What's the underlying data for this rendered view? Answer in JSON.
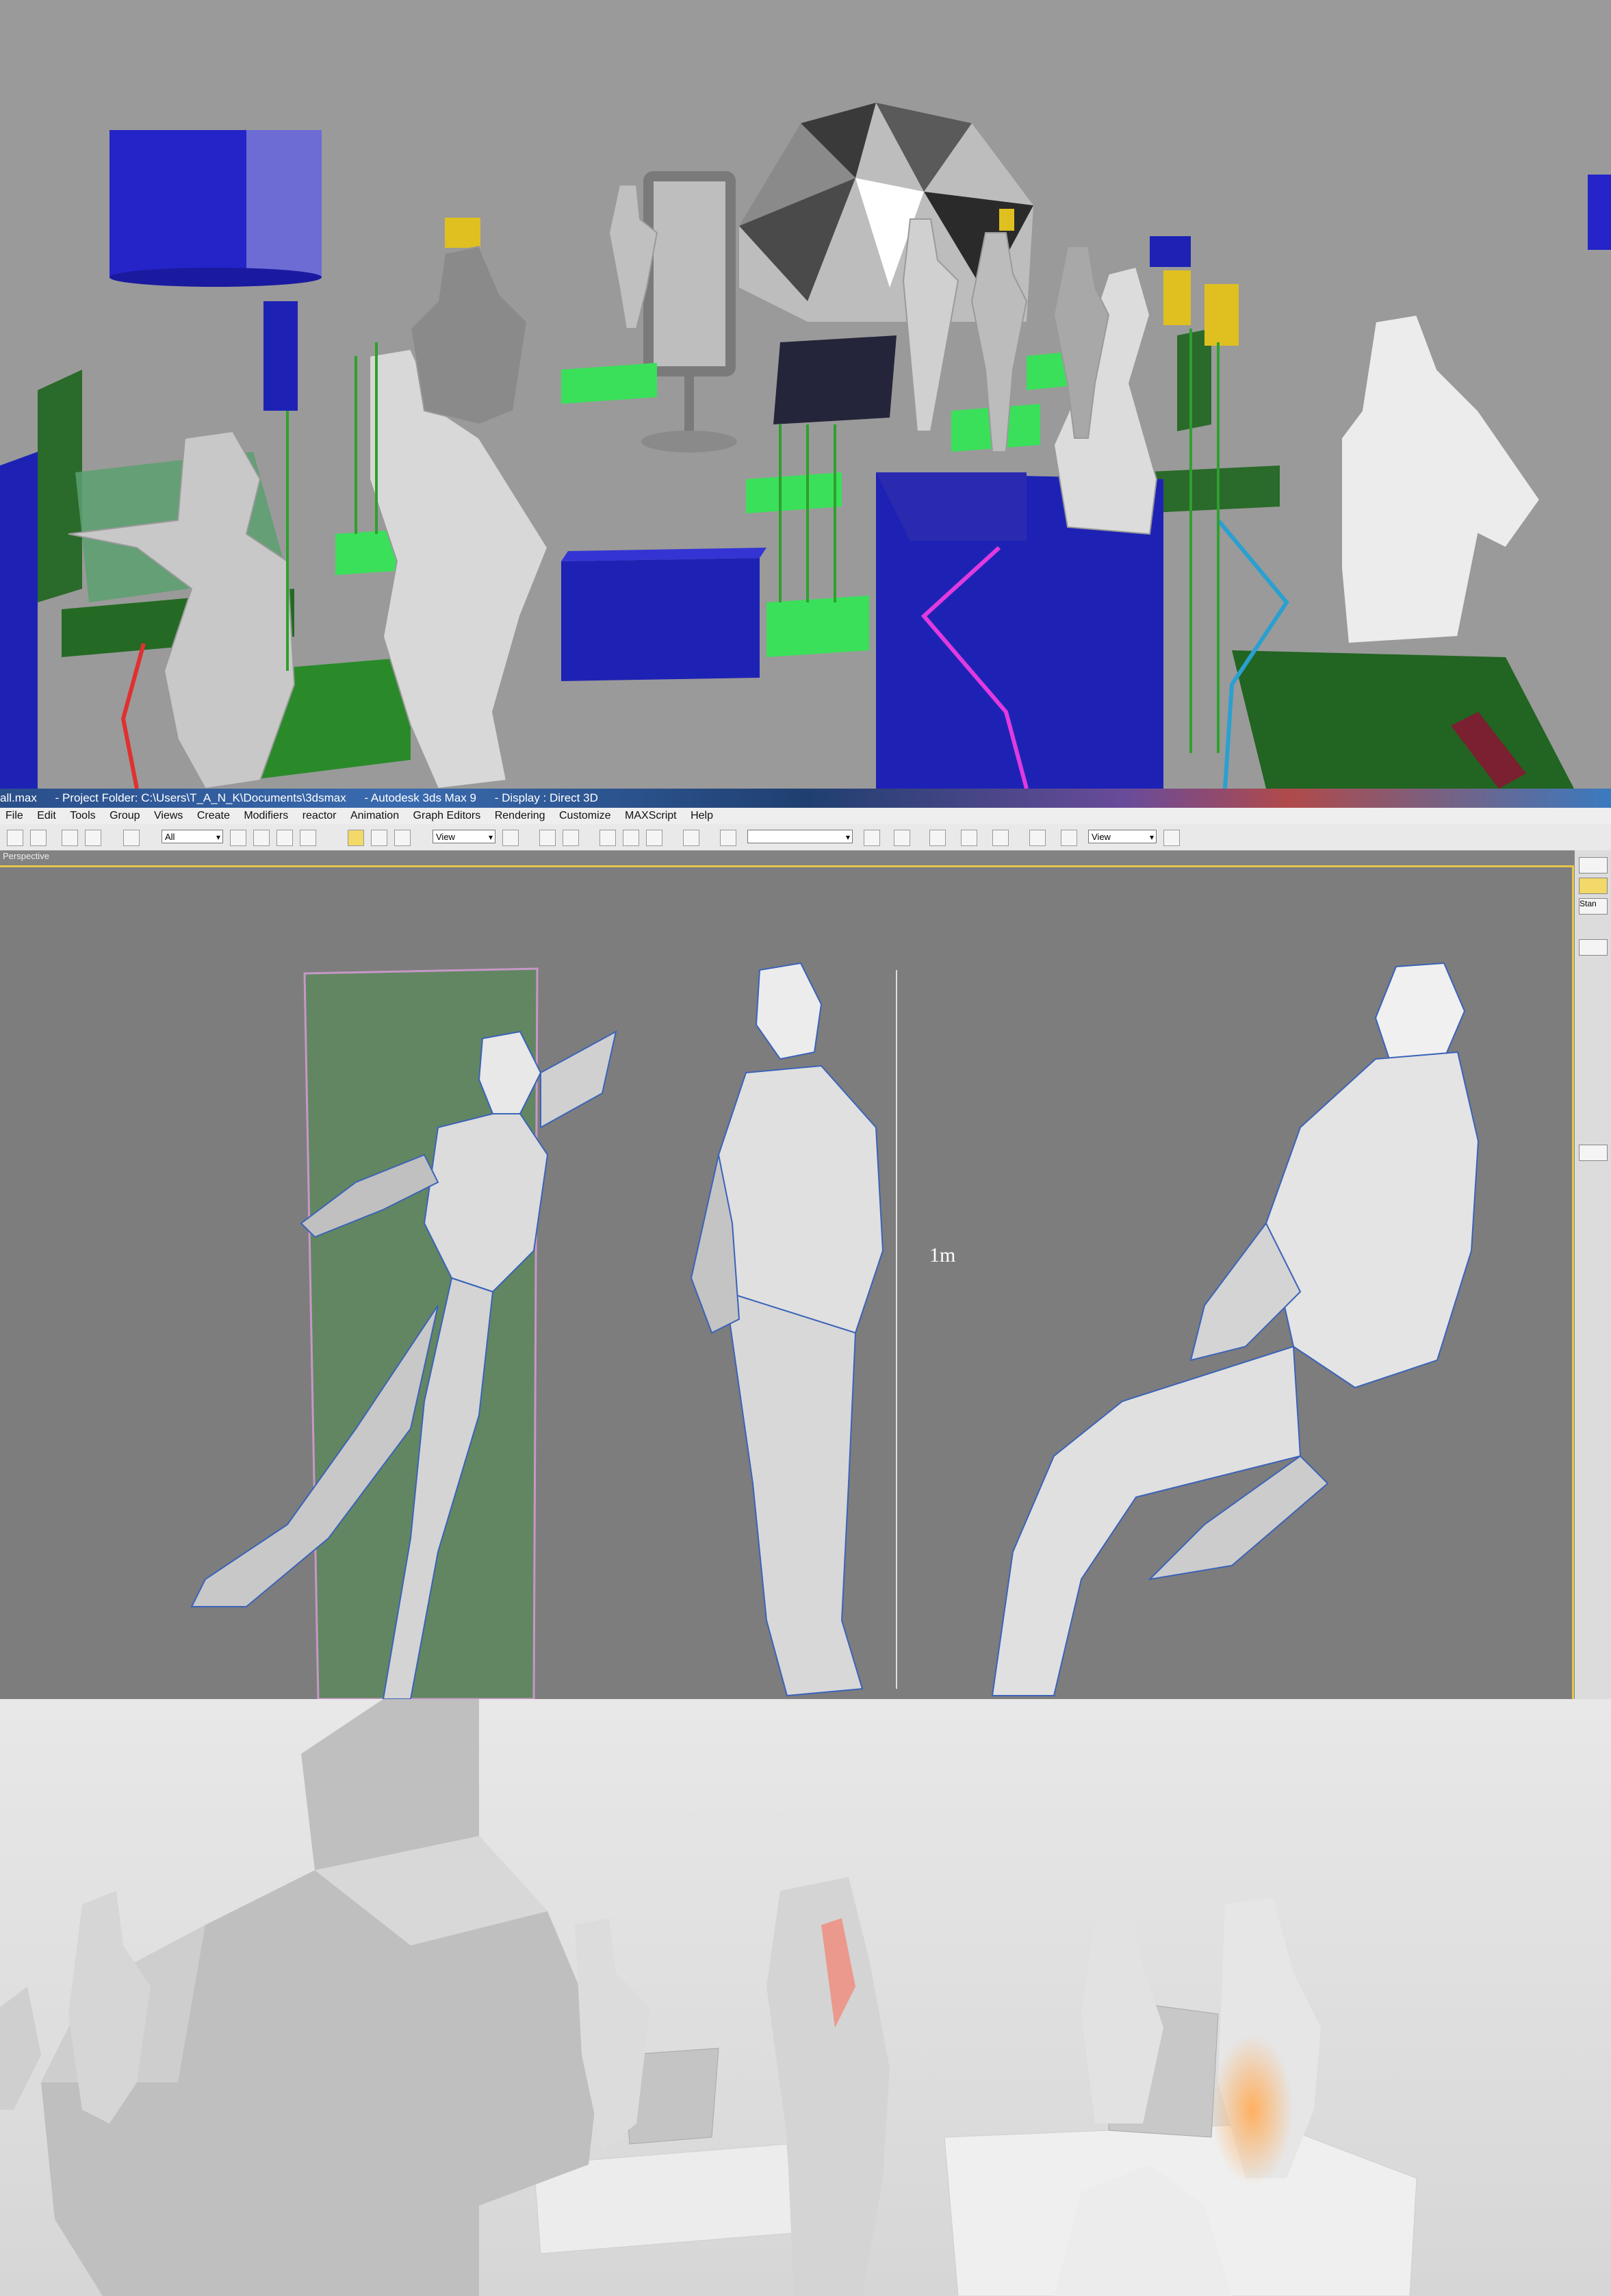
{
  "titlebar": {
    "file": "all.max",
    "project": "- Project Folder: C:\\Users\\T_A_N_K\\Documents\\3dsmax",
    "app": "- Autodesk 3ds Max 9",
    "display": "- Display : Direct 3D"
  },
  "menu": {
    "items": [
      "File",
      "Edit",
      "Tools",
      "Group",
      "Views",
      "Create",
      "Modifiers",
      "reactor",
      "Animation",
      "Graph Editors",
      "Rendering",
      "Customize",
      "MAXScript",
      "Help"
    ]
  },
  "toolbar": {
    "selection_filter": "All",
    "ref_coord_1": "View",
    "named_selection": "",
    "ref_coord_2": "View"
  },
  "viewport": {
    "label": "Perspective",
    "scale_label": "1m"
  },
  "command_panel": {
    "field_label": "Stan"
  },
  "colors": {
    "viewport_border": "#e6c64a",
    "wire_blue": "#3b63b8",
    "box_blue": "#1e22b4",
    "pad_green": "#2ee04a",
    "panel_green": "#2a6a2a"
  }
}
